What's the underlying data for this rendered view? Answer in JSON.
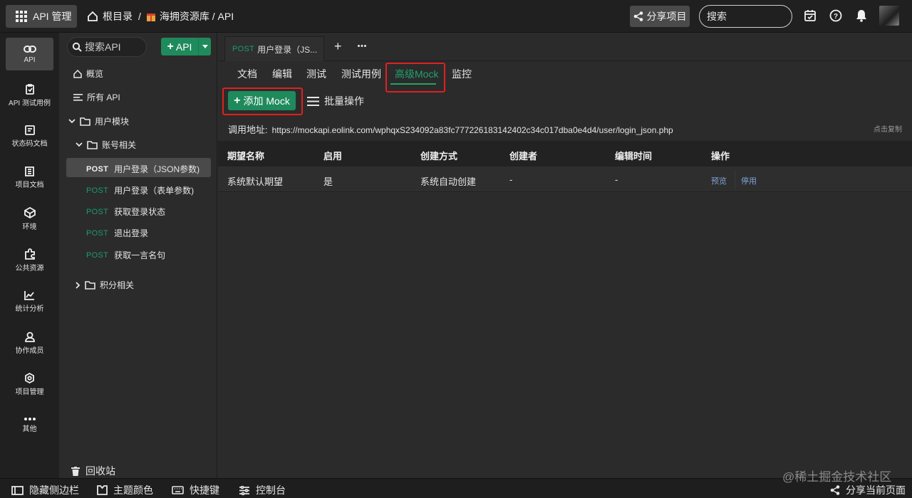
{
  "topbar": {
    "app_title": "API 管理",
    "breadcrumb_root": "根目录",
    "breadcrumb_sep1": "/",
    "breadcrumb_project": "海拥资源库 / API",
    "share_project": "分享项目",
    "search_placeholder": "搜索"
  },
  "rail": {
    "items": [
      {
        "label": "API",
        "icon": "link-icon"
      },
      {
        "label": "API 测试用例",
        "icon": "clipboard-icon"
      },
      {
        "label": "状态码文档",
        "icon": "code-doc-icon"
      },
      {
        "label": "项目文档",
        "icon": "book-icon"
      },
      {
        "label": "环境",
        "icon": "cube-icon"
      },
      {
        "label": "公共资源",
        "icon": "puzzle-icon"
      },
      {
        "label": "统计分析",
        "icon": "chart-icon"
      },
      {
        "label": "协作成员",
        "icon": "user-icon"
      },
      {
        "label": "项目管理",
        "icon": "settings-icon"
      },
      {
        "label": "其他",
        "icon": "more-icon"
      }
    ]
  },
  "tree": {
    "search_placeholder": "搜索API",
    "add_api": "API",
    "overview": "概览",
    "all_api": "所有 API",
    "group_user": "用户模块",
    "group_account": "账号相关",
    "method": "POST",
    "apis": [
      "用户登录（JSON参数)",
      "用户登录（表单参数)",
      "获取登录状态",
      "退出登录",
      "获取一言名句"
    ],
    "group_points": "积分相关",
    "trash": "回收站"
  },
  "main": {
    "open_tab_method": "POST",
    "open_tab_label": "用户登录（JS...",
    "subtabs": [
      "文档",
      "编辑",
      "测试",
      "测试用例",
      "高级Mock",
      "监控"
    ],
    "active_subtab": "高级Mock",
    "add_mock": "添加 Mock",
    "batch_ops": "批量操作",
    "url_label": "调用地址:",
    "url": "https://mockapi.eolink.com/wphqxS234092a83fc777226183142402c34c017dba0e4d4/user/login_json.php",
    "copy": "点击复制",
    "table": {
      "headers": [
        "期望名称",
        "启用",
        "创建方式",
        "创建者",
        "编辑时间",
        "操作"
      ],
      "row": {
        "name": "系统默认期望",
        "enabled": "是",
        "method": "系统自动创建",
        "creator": "-",
        "edited": "-",
        "action_preview": "预览",
        "action_disable": "停用"
      }
    }
  },
  "statusbar": {
    "hide_sidebar": "隐藏侧边栏",
    "theme": "主题颜色",
    "shortcuts": "快捷键",
    "console": "控制台",
    "share_page": "分享当前页面"
  },
  "watermark": "@稀土掘金技术社区",
  "colors": {
    "accent": "#21a36d",
    "button": "#1f8a5c",
    "highlight": "#e02020",
    "link": "#7fa3d6"
  }
}
